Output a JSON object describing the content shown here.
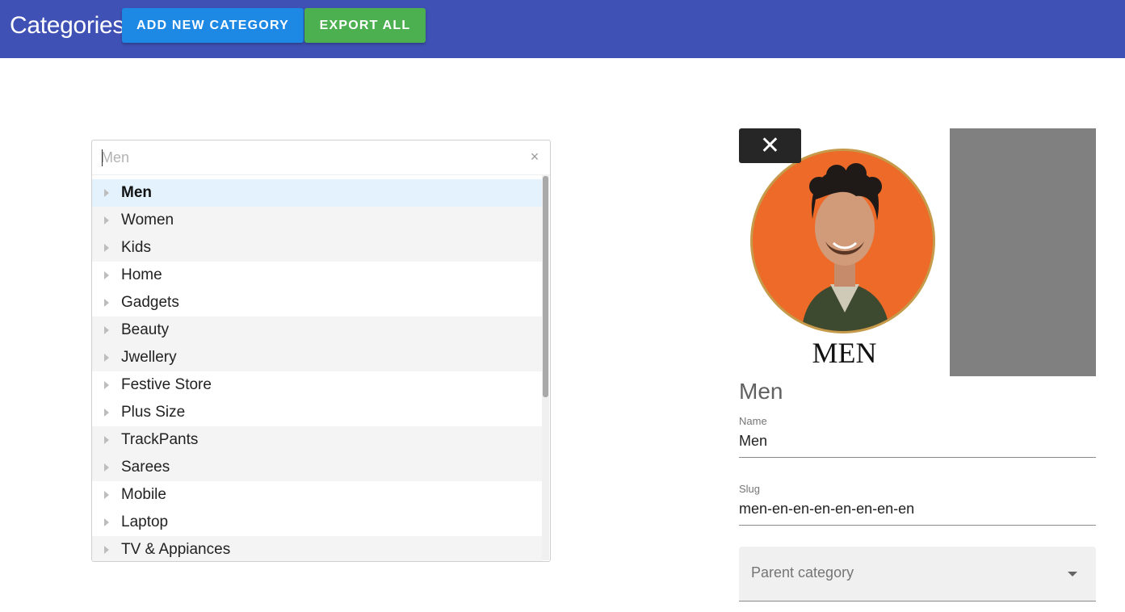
{
  "header": {
    "title": "Categories",
    "add_button_label": "ADD NEW CATEGORY",
    "export_button_label": "EXPORT ALL",
    "background_color": "#3f51b5",
    "add_button_color": "#1e88e5",
    "export_button_color": "#4caf50"
  },
  "tree": {
    "search_placeholder": "Men",
    "clear_icon": "×",
    "items": [
      {
        "label": "Men",
        "selected": true
      },
      {
        "label": "Women"
      },
      {
        "label": "Kids"
      },
      {
        "label": "Home"
      },
      {
        "label": "Gadgets"
      },
      {
        "label": "Beauty"
      },
      {
        "label": "Jwellery"
      },
      {
        "label": "Festive Store"
      },
      {
        "label": "Plus Size"
      },
      {
        "label": "TrackPants"
      },
      {
        "label": "Sarees"
      },
      {
        "label": "Mobile"
      },
      {
        "label": "Laptop"
      },
      {
        "label": "TV & Appiances"
      }
    ]
  },
  "detail": {
    "close_icon": "✕",
    "image_caption": "MEN",
    "title": "Men",
    "name_label": "Name",
    "name_value": "Men",
    "slug_label": "Slug",
    "slug_value": "men-en-en-en-en-en-en-en",
    "parent_placeholder": "Parent category"
  }
}
